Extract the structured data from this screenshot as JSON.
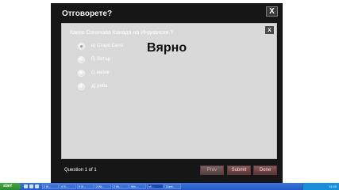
{
  "dialog": {
    "title": "Отговорете?",
    "close_glyph": "X",
    "panel_close_glyph": "x"
  },
  "quiz": {
    "question": "Какво Означава Канада на Индиански ?",
    "answers": [
      {
        "label": "а) Старо Село",
        "selected": true
      },
      {
        "label": "б) Вятър",
        "selected": false
      },
      {
        "label": "с) велик",
        "selected": false
      },
      {
        "label": "д) риба",
        "selected": false
      }
    ],
    "feedback": "Вярно",
    "counter": "Question 1 of 1"
  },
  "buttons": {
    "prev": "Prev",
    "next": "Submit",
    "done": "Done"
  },
  "taskbar": {
    "start_label": "start",
    "tasks": [
      "2 W...",
      "4 IC...",
      "5 Vi...",
      "2 Wi...",
      "2 Wi...",
      "Win...",
      "Mi...",
      "Corel..."
    ],
    "tray_text": "12:45"
  }
}
